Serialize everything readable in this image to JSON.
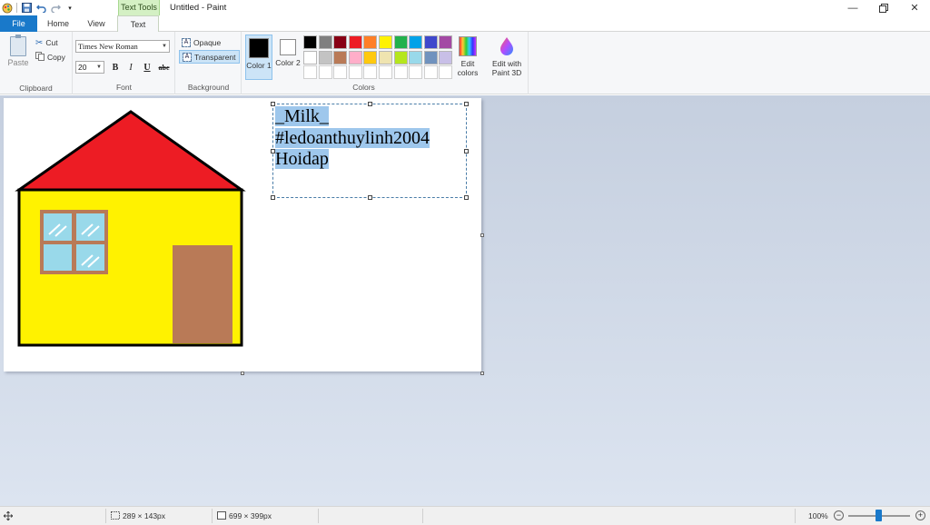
{
  "window": {
    "title": "Untitled - Paint",
    "context_tab": "Text Tools"
  },
  "tabs": [
    "File",
    "Home",
    "View",
    "Text"
  ],
  "ribbon": {
    "clipboard": {
      "paste": "Paste",
      "cut": "Cut",
      "copy": "Copy",
      "label": "Clipboard"
    },
    "font": {
      "family": "Times New Roman",
      "size": "20",
      "bold": "B",
      "italic": "I",
      "underline": "U",
      "strike": "abc",
      "label": "Font"
    },
    "background": {
      "opaque": "Opaque",
      "transparent": "Transparent",
      "label": "Background",
      "selected": "Transparent"
    },
    "colors": {
      "color1_label": "Color 1",
      "color1_value": "#000000",
      "color2_label": "Color 2",
      "color2_value": "#ffffff",
      "edit_colors": "Edit colors",
      "label": "Colors",
      "palette": [
        "#000000",
        "#7f7f7f",
        "#880015",
        "#ed1c24",
        "#ff7f27",
        "#fff200",
        "#22b14c",
        "#00a2e8",
        "#3f48cc",
        "#a349a4",
        "#ffffff",
        "#c3c3c3",
        "#b97a57",
        "#ffaec9",
        "#ffc90e",
        "#efe4b0",
        "#b5e61d",
        "#99d9ea",
        "#7092be",
        "#c8bfe7",
        "#ffffff",
        "#ffffff",
        "#ffffff",
        "#ffffff",
        "#ffffff",
        "#ffffff",
        "#ffffff",
        "#ffffff",
        "#ffffff",
        "#ffffff"
      ]
    },
    "paint3d": "Edit with Paint 3D"
  },
  "canvas": {
    "text_lines": [
      "_Milk_",
      "#ledoanthuylinh2004",
      "Hoidap"
    ],
    "house": {
      "roof_color": "#ed1c24",
      "wall_color": "#fff200",
      "door_color": "#b97a57",
      "window_frame_color": "#b97a57",
      "window_glass_color": "#99d9ea",
      "outline_color": "#000000"
    }
  },
  "status": {
    "selection_size": "289 × 143px",
    "canvas_size": "699 × 399px",
    "zoom": "100%"
  }
}
